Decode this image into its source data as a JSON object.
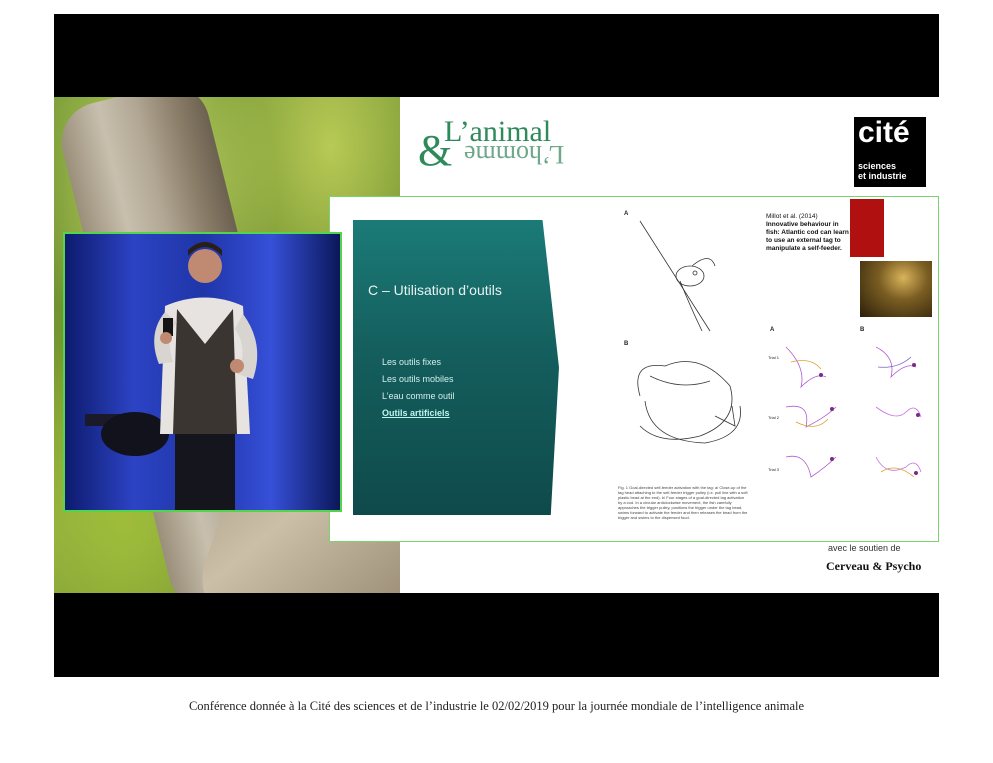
{
  "video": {
    "logo": {
      "amp": "&",
      "line1": "L’animal",
      "line2": "L’homme"
    },
    "cite_logo": {
      "big": "cité",
      "line1": "sciences",
      "line2": "et industrie"
    },
    "sponsor": {
      "text": "avec le soutien de",
      "brand": "Cerveau & Psycho"
    },
    "slide": {
      "title": "C – Utilisation d’outils",
      "items": [
        {
          "label": "Les outils fixes",
          "active": false
        },
        {
          "label": "Les outils mobiles",
          "active": false
        },
        {
          "label": "L’eau comme outil",
          "active": false
        },
        {
          "label": "Outils artificiels",
          "active": true
        }
      ],
      "figure_labels": [
        "A",
        "B"
      ],
      "figure_caption": "Fig. 1 Goal-directed self-feeder activation with the tag: a/ Close-up of the tag head attaching to the self-feeder trigger pulley (i.e. pull line with a soft plastic bead at the end). b/ Four stages of a goal-directed tag activation by a cod. In a circular anticlockwise movement, the fish carefully approaches the trigger pulley, positions the trigger under the tag bead, swims forward to activate the feeder and then releases the bead from the trigger and swims to the dispensed food.",
      "ref_author": "Millot et al. (2014)",
      "ref_title": "Innovative behaviour in fish: Atlantic cod can learn to use an external tag to manipulate a self-feeder.",
      "plot_labels": [
        "A",
        "B",
        "Trial 1",
        "Trial 2",
        "Trial 3"
      ]
    },
    "colors": {
      "slide_teal": "#145e5d",
      "logo_green": "#2e8a5a",
      "frame_border": "#52d44c"
    }
  },
  "caption": "Conférence donnée à la Cité des sciences et de l’industrie le 02/02/2019 pour la journée mondiale de l’intelligence animale"
}
